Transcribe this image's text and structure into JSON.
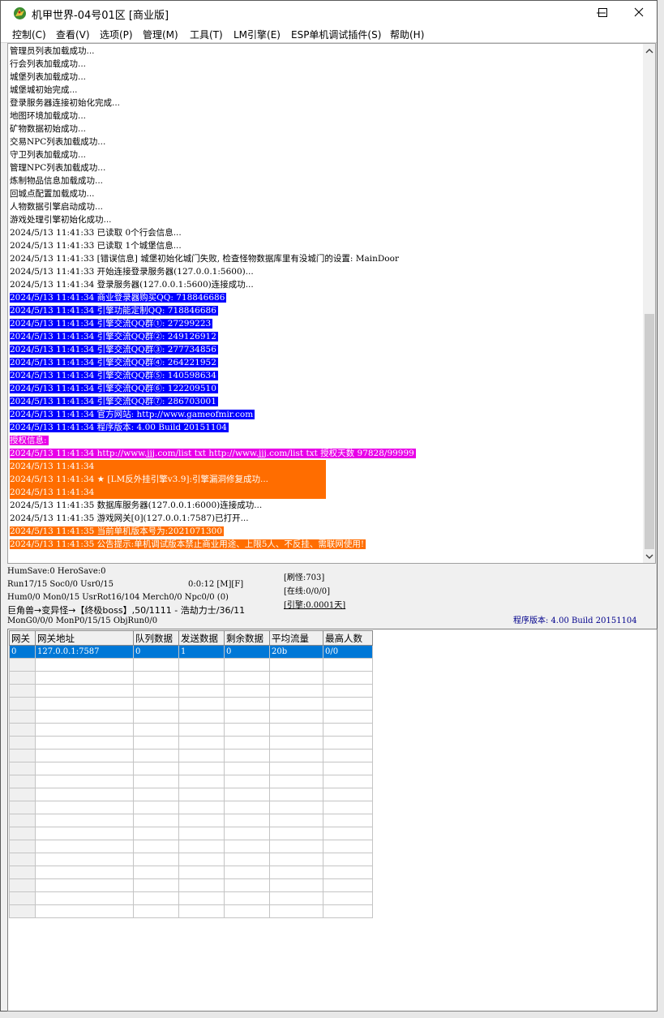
{
  "window": {
    "title": "机甲世界-04号01区 [商业版]",
    "icon": "dragon-app-icon"
  },
  "menu": [
    {
      "label": "控制(C)"
    },
    {
      "label": "查看(V)"
    },
    {
      "label": "选项(P)"
    },
    {
      "label": "管理(M)"
    },
    {
      "label": "工具(T)"
    },
    {
      "label": "LM引擎(E)"
    },
    {
      "label": "ESP单机调试插件(S)"
    },
    {
      "label": "帮助(H)"
    }
  ],
  "log": [
    {
      "text": "管理员列表加载成功...",
      "style": ""
    },
    {
      "text": "行会列表加载成功...",
      "style": ""
    },
    {
      "text": "城堡列表加载成功...",
      "style": ""
    },
    {
      "text": "城堡城初始完成...",
      "style": ""
    },
    {
      "text": "登录服务器连接初始化完成...",
      "style": ""
    },
    {
      "text": "地图环境加载成功...",
      "style": ""
    },
    {
      "text": "矿物数据初始成功...",
      "style": ""
    },
    {
      "text": "交易NPC列表加载成功...",
      "style": ""
    },
    {
      "text": "守卫列表加载成功...",
      "style": ""
    },
    {
      "text": "管理NPC列表加载成功...",
      "style": ""
    },
    {
      "text": "炼制物品信息加载成功...",
      "style": ""
    },
    {
      "text": "回城点配置加载成功...",
      "style": ""
    },
    {
      "text": "人物数据引擎启动成功...",
      "style": ""
    },
    {
      "text": "游戏处理引擎初始化成功...",
      "style": ""
    },
    {
      "text": "2024/5/13 11:41:33 已读取 0个行会信息...",
      "style": ""
    },
    {
      "text": "2024/5/13 11:41:33 已读取 1个城堡信息...",
      "style": ""
    },
    {
      "text": "2024/5/13 11:41:33 [错误信息] 城堡初始化城门失败, 检查怪物数据库里有没城门的设置: MainDoor",
      "style": ""
    },
    {
      "text": "2024/5/13 11:41:33 开始连接登录服务器(127.0.0.1:5600)...",
      "style": ""
    },
    {
      "text": "2024/5/13 11:41:34 登录服务器(127.0.0.1:5600)连接成功...",
      "style": ""
    },
    {
      "text": "2024/5/13 11:41:34 商业登录器购买QQ: 718846686",
      "style": "blue"
    },
    {
      "text": "2024/5/13 11:41:34 引擎功能定制QQ: 718846686",
      "style": "blue"
    },
    {
      "text": "2024/5/13 11:41:34 引擎交流QQ群①: 27299223",
      "style": "blue"
    },
    {
      "text": "2024/5/13 11:41:34 引擎交流QQ群②: 249126912",
      "style": "blue"
    },
    {
      "text": "2024/5/13 11:41:34 引擎交流QQ群③: 277734856",
      "style": "blue"
    },
    {
      "text": "2024/5/13 11:41:34 引擎交流QQ群④: 264221952",
      "style": "blue"
    },
    {
      "text": "2024/5/13 11:41:34 引擎交流QQ群⑤: 140598634",
      "style": "blue"
    },
    {
      "text": "2024/5/13 11:41:34 引擎交流QQ群⑥: 122209510",
      "style": "blue"
    },
    {
      "text": "2024/5/13 11:41:34 引擎交流QQ群⑦: 286703001",
      "style": "blue"
    },
    {
      "text": "2024/5/13 11:41:34 官方网站: http://www.gameofmir.com",
      "style": "blue"
    },
    {
      "text": "2024/5/13 11:41:34 程序版本: 4.00 Build 20151104",
      "style": "blue"
    },
    {
      "text": "授权信息:",
      "style": "mag"
    },
    {
      "text": "2024/5/13 11:41:34 http://www.jjj.com/list txt http://www.jjj.com/list txt 授权天数 97828/99999",
      "style": "mag"
    },
    {
      "text": "2024/5/13 11:41:34 ",
      "style": "orgbar"
    },
    {
      "text": "2024/5/13 11:41:34 ★ [LM反外挂引擎v3.9]:引擎漏洞修复成功...",
      "style": "orgbar"
    },
    {
      "text": "2024/5/13 11:41:34 ",
      "style": "orgbar"
    },
    {
      "text": "2024/5/13 11:41:35 数据库服务器(127.0.0.1:6000)连接成功...",
      "style": ""
    },
    {
      "text": "2024/5/13 11:41:35 游戏网关[0](127.0.0.1:7587)已打开...",
      "style": ""
    },
    {
      "text": "2024/5/13 11:41:35 当前单机版本号为:2021071300",
      "style": "org"
    },
    {
      "text": "2024/5/13 11:41:35 公告提示:单机调试版本禁止商业用途、上限5人、不反挂、需联网使用!",
      "style": "org"
    }
  ],
  "status": {
    "line1": "HumSave:0 HeroSave:0",
    "line2": "Run17/15 Soc0/0 Usr0/15",
    "timer": "0:0:12 [M][F]",
    "line3": "Hum0/0 Mon0/15 UsrRot16/104 Merch0/0 Npc0/0 (0)",
    "line4": "巨角兽→变异怪→【终极boss】,50/1111 - 浩劫力士/36/11",
    "line5": "MonG0/0/0 MonP0/15/15 ObjRun0/0",
    "refresh": "[刷怪:703]",
    "online": "[在线:0/0/0]",
    "engine": "[引擎:0.0001天]",
    "version": "程序版本: 4.00 Build 20151104"
  },
  "gateway_table": {
    "headers": [
      "网关",
      "网关地址",
      "队列数据",
      "发送数据",
      "剩余数据",
      "平均流量",
      "最高人数"
    ],
    "rows": [
      [
        "0",
        "127.0.0.1:7587",
        "0",
        "1",
        "0",
        "20b",
        "0/0"
      ]
    ],
    "empty_rows": 20
  }
}
